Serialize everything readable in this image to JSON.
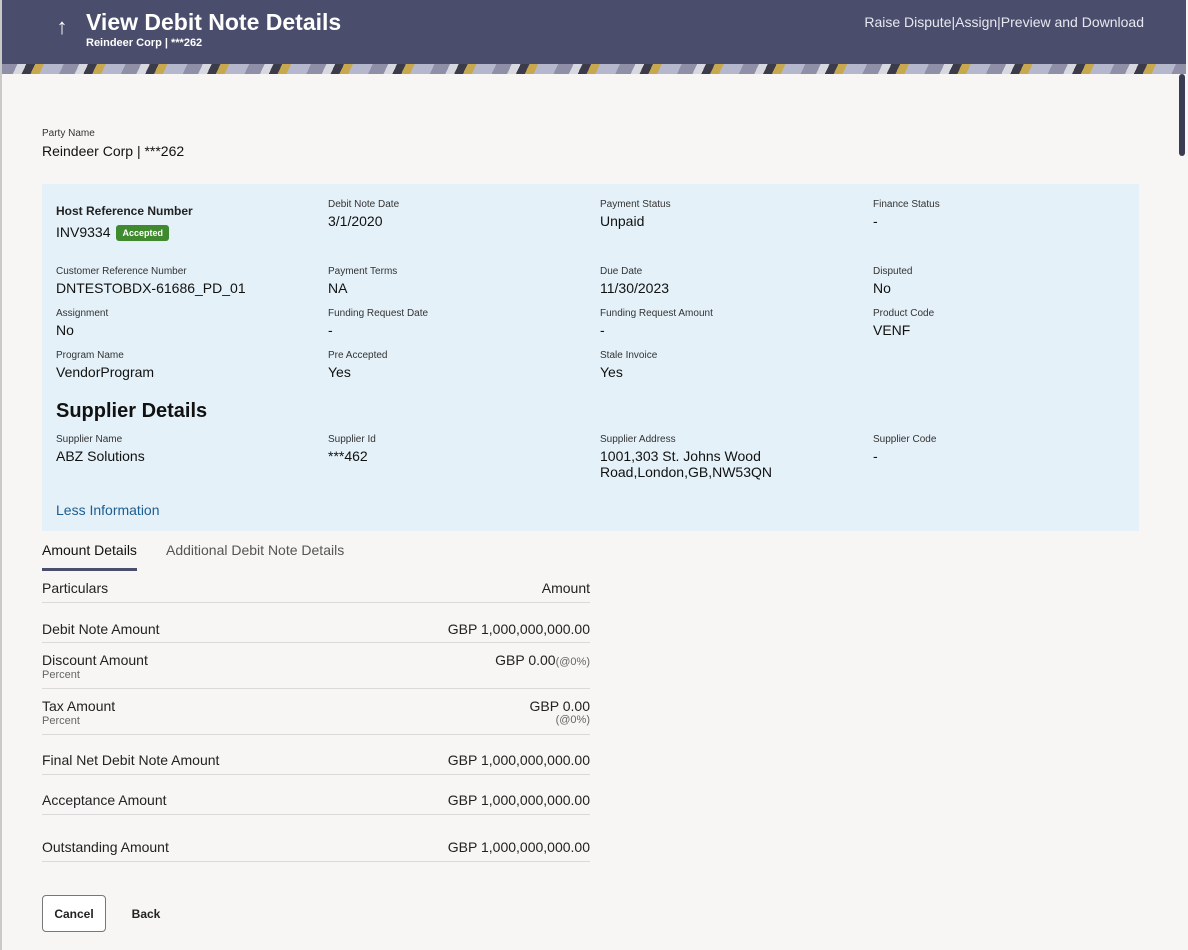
{
  "header": {
    "back_icon": "up-arrow-icon",
    "back_glyph": "↑",
    "title": "View Debit Note Details",
    "subtitle": "Reindeer Corp | ***262",
    "actions": {
      "raise_dispute": "Raise Dispute",
      "sep": "|",
      "assign": "Assign",
      "preview_download": "Preview and Download"
    }
  },
  "party": {
    "label": "Party Name",
    "value": "Reindeer Corp | ***262"
  },
  "details": {
    "host_ref": {
      "label": "Host Reference Number",
      "value": "INV9334",
      "badge": "Accepted",
      "badge_color": "#3f8a2e"
    },
    "debit_note_date": {
      "label": "Debit Note Date",
      "value": "3/1/2020"
    },
    "payment_status": {
      "label": "Payment Status",
      "value": "Unpaid"
    },
    "finance_status": {
      "label": "Finance Status",
      "value": "-"
    },
    "customer_ref": {
      "label": "Customer Reference Number",
      "value": "DNTESTOBDX-61686_PD_01"
    },
    "payment_terms": {
      "label": "Payment Terms",
      "value": "NA"
    },
    "due_date": {
      "label": "Due Date",
      "value": "11/30/2023"
    },
    "disputed": {
      "label": "Disputed",
      "value": "No"
    },
    "assignment": {
      "label": "Assignment",
      "value": "No"
    },
    "funding_request_date": {
      "label": "Funding Request Date",
      "value": "-"
    },
    "funding_request_amount": {
      "label": "Funding Request Amount",
      "value": "-"
    },
    "product_code": {
      "label": "Product Code",
      "value": "VENF"
    },
    "program_name": {
      "label": "Program Name",
      "value": "VendorProgram"
    },
    "pre_accepted": {
      "label": "Pre Accepted",
      "value": "Yes"
    },
    "stale_invoice": {
      "label": "Stale Invoice",
      "value": "Yes"
    }
  },
  "supplier": {
    "title": "Supplier Details",
    "name": {
      "label": "Supplier Name",
      "value": "ABZ Solutions"
    },
    "id": {
      "label": "Supplier Id",
      "value": "***462"
    },
    "address": {
      "label": "Supplier Address",
      "line1": "1001,303 St. Johns Wood",
      "line2": "Road,London,GB,NW53QN"
    },
    "code": {
      "label": "Supplier Code",
      "value": "-"
    }
  },
  "less_info": "Less Information",
  "tabs": [
    {
      "label": "Amount Details",
      "active": true
    },
    {
      "label": "Additional Debit Note Details",
      "active": false
    }
  ],
  "amount_table": {
    "headers": {
      "particulars": "Particulars",
      "amount": "Amount"
    },
    "rows": [
      {
        "name": "Debit Note Amount",
        "amount": "GBP 1,000,000,000.00"
      },
      {
        "name": "Discount Amount",
        "sub": "Percent",
        "amount": "GBP 0.00",
        "pct": "(@0%)"
      },
      {
        "name": "Tax Amount",
        "sub": "Percent",
        "amount": "GBP 0.00",
        "pct": "(@0%)"
      },
      {
        "name": "Final Net Debit Note Amount",
        "amount": "GBP 1,000,000,000.00"
      },
      {
        "name": "Acceptance Amount",
        "amount": "GBP 1,000,000,000.00"
      },
      {
        "name": "Outstanding Amount",
        "amount": "GBP 1,000,000,000.00"
      }
    ]
  },
  "buttons": {
    "cancel": "Cancel",
    "back": "Back"
  }
}
